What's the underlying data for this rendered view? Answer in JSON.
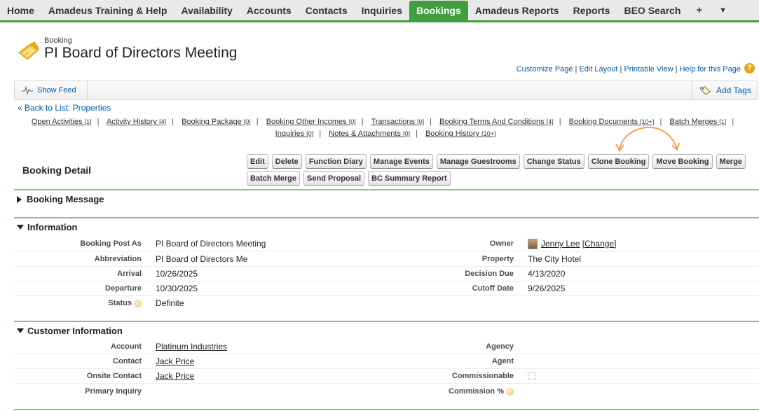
{
  "nav": {
    "tabs": [
      "Home",
      "Amadeus Training & Help",
      "Availability",
      "Accounts",
      "Contacts",
      "Inquiries",
      "Bookings",
      "Amadeus Reports",
      "Reports",
      "BEO Search"
    ],
    "active": "Bookings",
    "plus_icon": "+",
    "more_icon": "▼"
  },
  "header": {
    "record_type": "Booking",
    "title": "PI Board of Directors Meeting",
    "links": [
      "Customize Page",
      "Edit Layout",
      "Printable View",
      "Help for this Page"
    ],
    "help_icon": "?"
  },
  "feedbar": {
    "show_feed": "Show Feed",
    "add_tags": "Add Tags"
  },
  "back_link": "« Back to List: Properties",
  "related_lists": {
    "line1": [
      {
        "label": "Open Activities",
        "count": "[1]"
      },
      {
        "label": "Activity History",
        "count": "[4]"
      },
      {
        "label": "Booking Package",
        "count": "[0]"
      },
      {
        "label": "Booking Other Incomes",
        "count": "[0]"
      },
      {
        "label": "Transactions",
        "count": "[0]"
      },
      {
        "label": "Booking Terms And Conditions",
        "count": "[4]"
      },
      {
        "label": "Booking Documents",
        "count": "[10+]"
      },
      {
        "label": "Batch Merges",
        "count": "[1]"
      }
    ],
    "line2": [
      {
        "label": "Inquiries",
        "count": "[0]"
      },
      {
        "label": "Notes & Attachments",
        "count": "[0]"
      },
      {
        "label": "Booking History",
        "count": "[10+]"
      }
    ]
  },
  "detail": {
    "title": "Booking Detail",
    "buttons_row1": [
      "Edit",
      "Delete",
      "Function Diary",
      "Manage Events",
      "Manage Guestrooms",
      "Change Status",
      "Clone Booking",
      "Move Booking",
      "Merge"
    ],
    "buttons_row2": [
      "Batch Merge",
      "Send Proposal",
      "BC Summary Report"
    ]
  },
  "sections": {
    "booking_message": "Booking Message",
    "information": "Information",
    "customer_information": "Customer Information"
  },
  "information": {
    "booking_post_as": {
      "label": "Booking Post As",
      "value": "PI Board of Directors Meeting"
    },
    "abbreviation": {
      "label": "Abbreviation",
      "value": "PI Board of Directors Me"
    },
    "arrival": {
      "label": "Arrival",
      "value": "10/26/2025"
    },
    "departure": {
      "label": "Departure",
      "value": "10/30/2025"
    },
    "status": {
      "label": "Status",
      "value": "Definite"
    },
    "owner": {
      "label": "Owner",
      "value": "Jenny Lee",
      "change": "[Change]"
    },
    "property": {
      "label": "Property",
      "value": "The City Hotel"
    },
    "decision_due": {
      "label": "Decision Due",
      "value": "4/13/2020"
    },
    "cutoff_date": {
      "label": "Cutoff Date",
      "value": "9/26/2025"
    }
  },
  "customer": {
    "account": {
      "label": "Account",
      "value": "Platinum Industries"
    },
    "contact": {
      "label": "Contact",
      "value": "Jack Price"
    },
    "onsite_contact": {
      "label": "Onsite Contact",
      "value": "Jack Price"
    },
    "primary_inquiry": {
      "label": "Primary Inquiry",
      "value": ""
    },
    "agency": {
      "label": "Agency",
      "value": ""
    },
    "agent": {
      "label": "Agent",
      "value": ""
    },
    "commissionable": {
      "label": "Commissionable",
      "value": ""
    },
    "commission_pct": {
      "label": "Commission %",
      "value": ""
    }
  },
  "colors": {
    "nav_active": "#3f9f3f",
    "link": "#015ba7",
    "section_line": "#8fc08f",
    "annotation_arrow": "#f0a050"
  }
}
